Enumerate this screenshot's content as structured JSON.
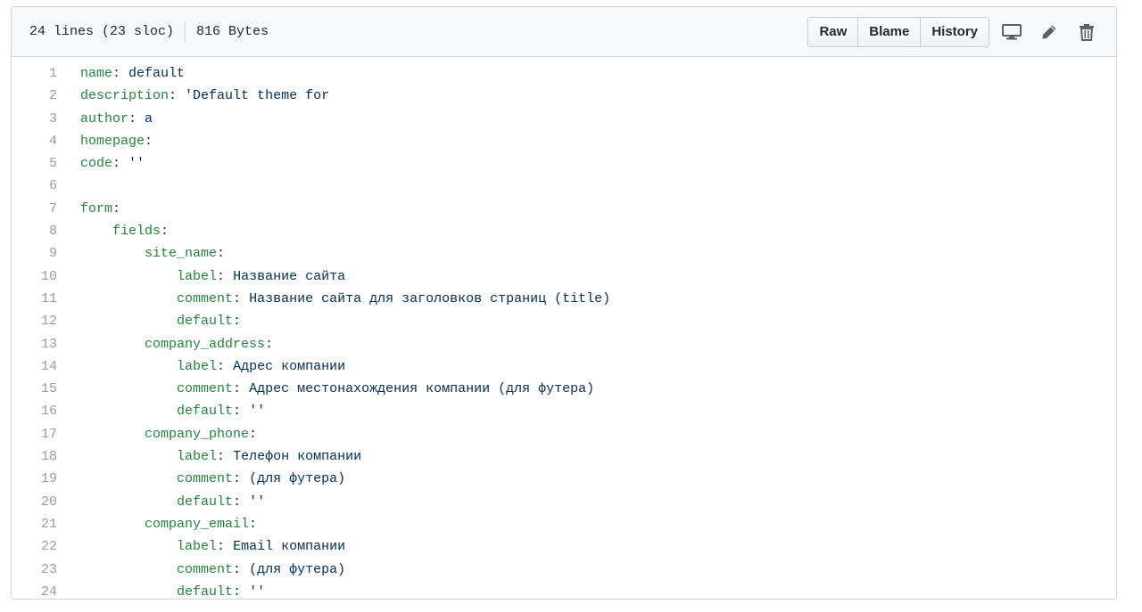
{
  "file_info": {
    "lines": "24 lines (23 sloc)",
    "size": "816 Bytes"
  },
  "toolbar": {
    "raw_label": "Raw",
    "blame_label": "Blame",
    "history_label": "History",
    "icons": [
      "desktop-icon",
      "pencil-icon",
      "trash-icon"
    ]
  },
  "colors": {
    "key": "#22863a",
    "value": "#032f62",
    "line_number": "#959da5",
    "header_bg": "#f6f8fa",
    "border": "#d1d5da"
  },
  "code_lines": [
    {
      "n": "1",
      "indent": "",
      "key": "name",
      "value": " default"
    },
    {
      "n": "2",
      "indent": "",
      "key": "description",
      "value": " 'Default theme for"
    },
    {
      "n": "3",
      "indent": "",
      "key": "author",
      "value": " a"
    },
    {
      "n": "4",
      "indent": "",
      "key": "homepage",
      "value": ""
    },
    {
      "n": "5",
      "indent": "",
      "key": "code",
      "value": " ''"
    },
    {
      "n": "6",
      "indent": "",
      "key": "",
      "value": ""
    },
    {
      "n": "7",
      "indent": "",
      "key": "form",
      "value": ""
    },
    {
      "n": "8",
      "indent": "    ",
      "key": "fields",
      "value": ""
    },
    {
      "n": "9",
      "indent": "        ",
      "key": "site_name",
      "value": ""
    },
    {
      "n": "10",
      "indent": "            ",
      "key": "label",
      "value": " Название сайта"
    },
    {
      "n": "11",
      "indent": "            ",
      "key": "comment",
      "value": " Название сайта для заголовков страниц (title)"
    },
    {
      "n": "12",
      "indent": "            ",
      "key": "default",
      "value": ""
    },
    {
      "n": "13",
      "indent": "        ",
      "key": "company_address",
      "value": ""
    },
    {
      "n": "14",
      "indent": "            ",
      "key": "label",
      "value": " Адрес компании"
    },
    {
      "n": "15",
      "indent": "            ",
      "key": "comment",
      "value": " Адрес местонахождения компании (для футера)"
    },
    {
      "n": "16",
      "indent": "            ",
      "key": "default",
      "value": " ''"
    },
    {
      "n": "17",
      "indent": "        ",
      "key": "company_phone",
      "value": ""
    },
    {
      "n": "18",
      "indent": "            ",
      "key": "label",
      "value": " Телефон компании"
    },
    {
      "n": "19",
      "indent": "            ",
      "key": "comment",
      "value": " (для футера)"
    },
    {
      "n": "20",
      "indent": "            ",
      "key": "default",
      "value": " ''"
    },
    {
      "n": "21",
      "indent": "        ",
      "key": "company_email",
      "value": ""
    },
    {
      "n": "22",
      "indent": "            ",
      "key": "label",
      "value": " Email компании"
    },
    {
      "n": "23",
      "indent": "            ",
      "key": "comment",
      "value": " (для футера)"
    },
    {
      "n": "24",
      "indent": "            ",
      "key": "default",
      "value": " ''"
    }
  ]
}
